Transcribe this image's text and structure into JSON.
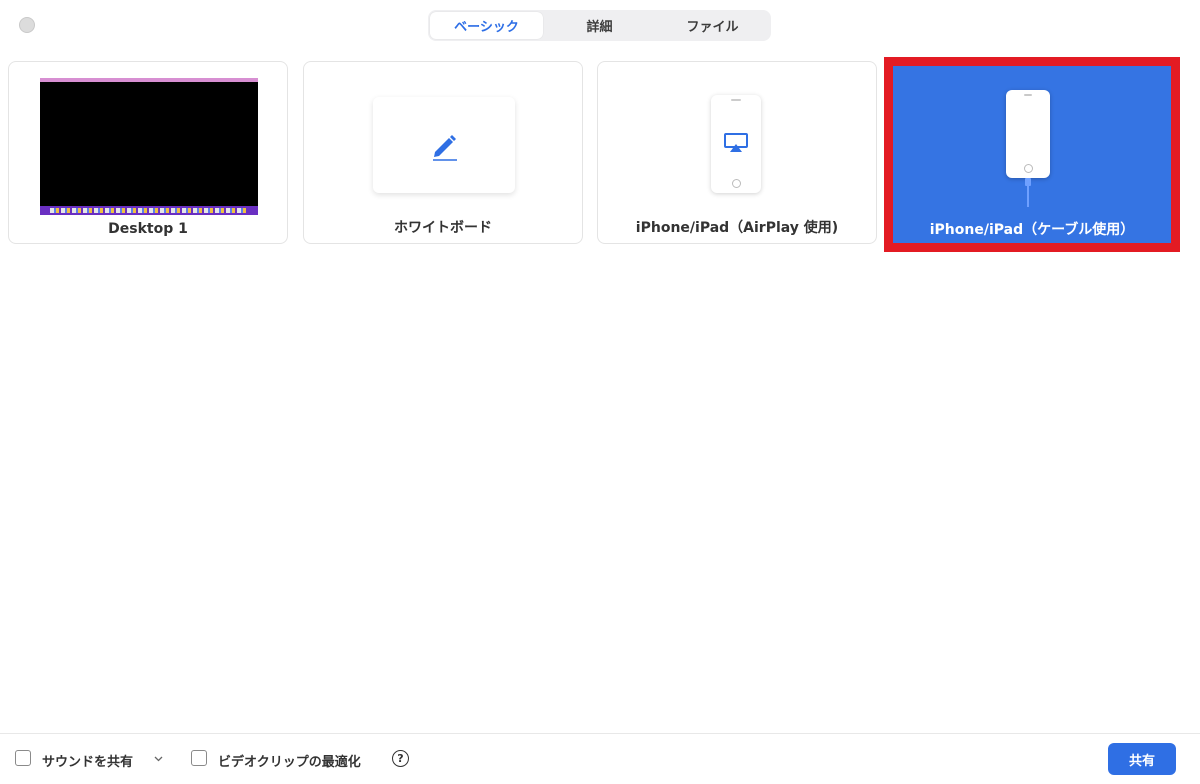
{
  "tabs": [
    {
      "label": "ベーシック",
      "active": true
    },
    {
      "label": "詳細",
      "active": false
    },
    {
      "label": "ファイル",
      "active": false
    }
  ],
  "cards": {
    "desktop": {
      "label": "Desktop 1"
    },
    "whiteboard": {
      "label": "ホワイトボード",
      "icon": "pencil-icon"
    },
    "airplay": {
      "label": "iPhone/iPad（AirPlay 使用)",
      "icon": "airplay-icon"
    },
    "cable": {
      "label": "iPhone/iPad（ケーブル使用）",
      "icon": "phone-cable-icon",
      "selected": true
    }
  },
  "bottom": {
    "share_sound": "サウンドを共有",
    "optimize_video": "ビデオクリップの最適化",
    "help": "?",
    "share_button": "共有"
  },
  "colors": {
    "accent": "#2f6fe4",
    "selected_card": "#3574e3",
    "highlight_border": "#e31b23"
  }
}
